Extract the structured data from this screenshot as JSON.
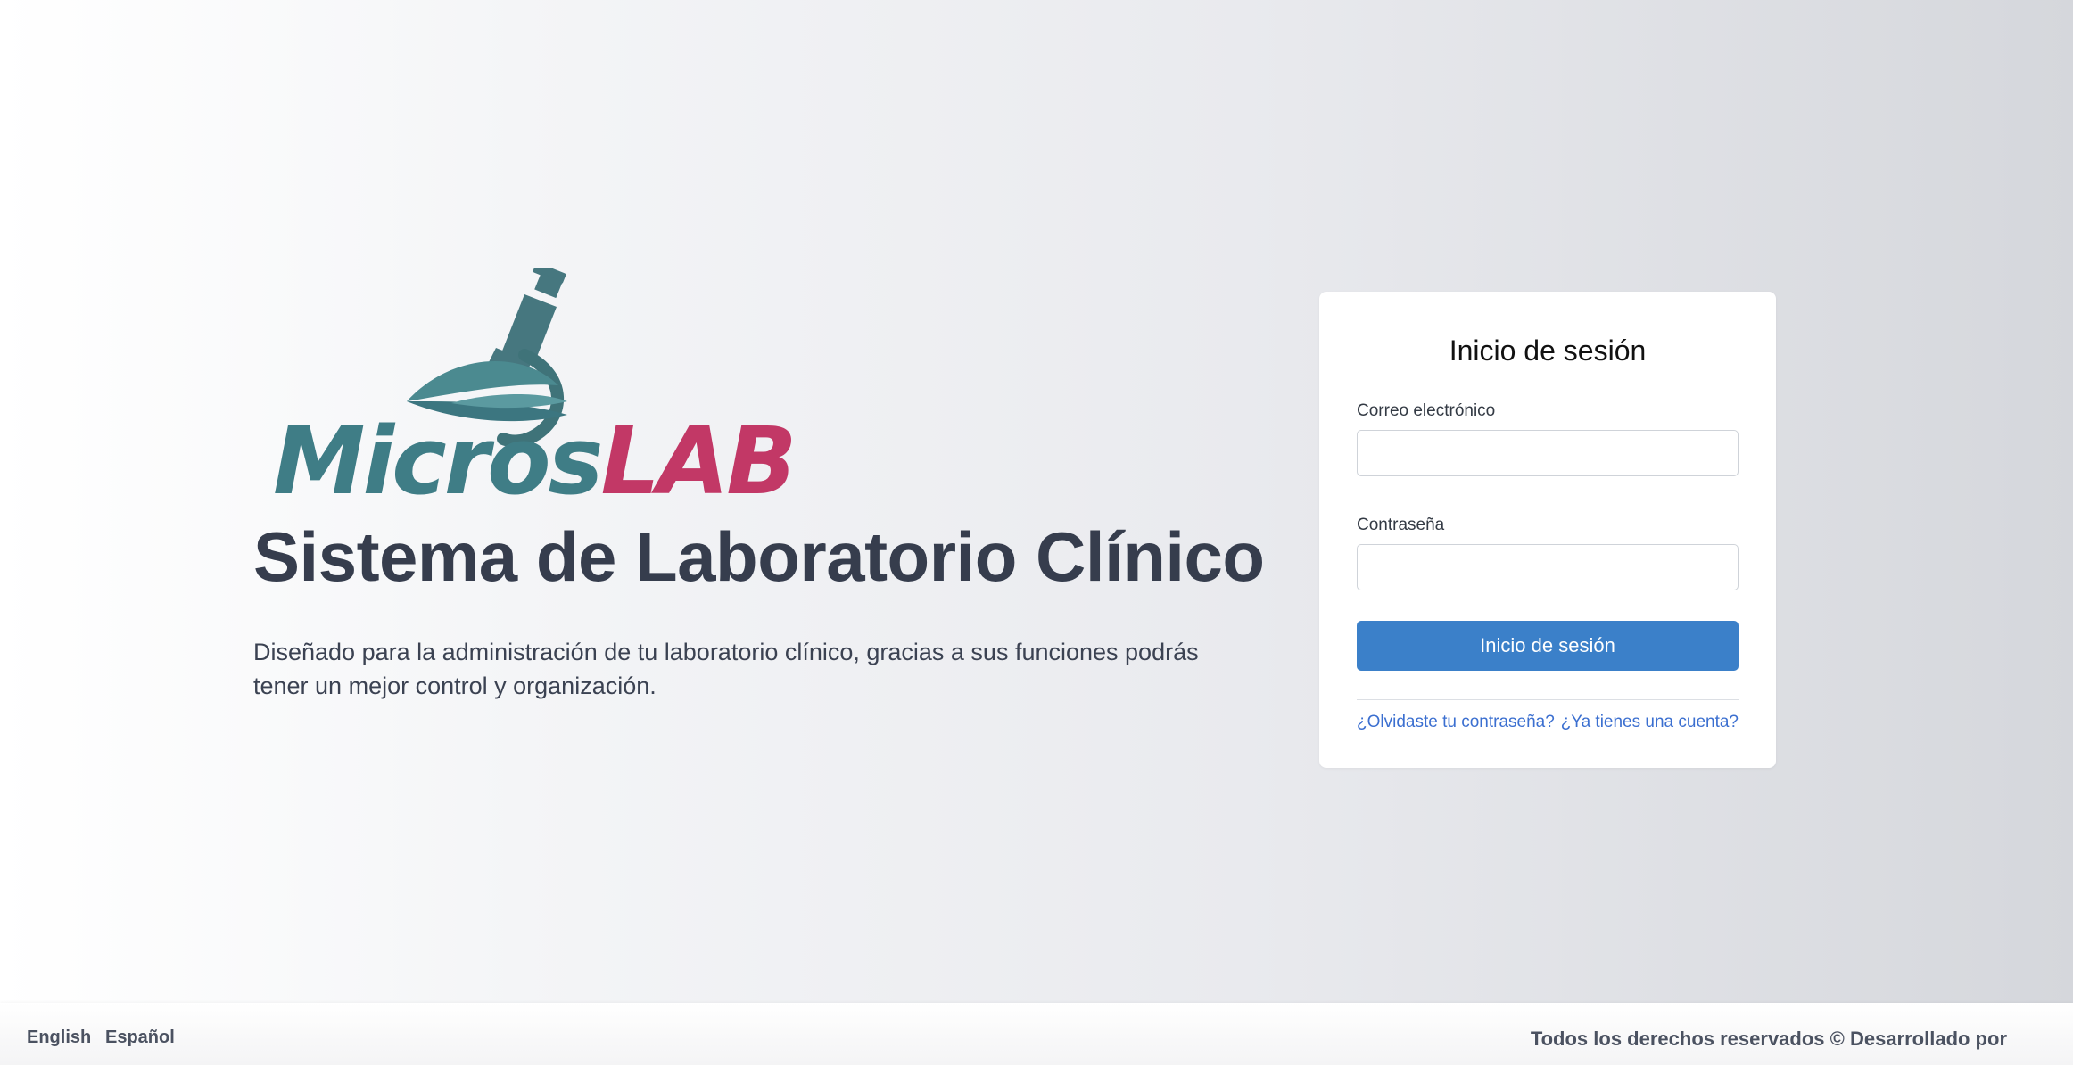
{
  "brand": {
    "logo_part1": "Micros",
    "logo_part2": "LAB",
    "colors": {
      "teal": "#3f7d86",
      "magenta": "#c23866"
    }
  },
  "hero": {
    "title": "Sistema de Laboratorio Clínico",
    "subtitle": "Diseñado para la administración de tu laboratorio clínico, gracias a sus funciones podrás tener un mejor control y organización."
  },
  "login": {
    "title": "Inicio de sesión",
    "email_label": "Correo electrónico",
    "email_value": "",
    "password_label": "Contraseña",
    "password_value": "",
    "submit_label": "Inicio de sesión",
    "forgot_link": "¿Olvidaste tu contraseña?",
    "account_link": "¿Ya tienes una cuenta?",
    "accent_color": "#3b80c9"
  },
  "footer": {
    "lang_en": "English",
    "lang_es": "Español",
    "copyright": "Todos los derechos reservados © Desarrollado por"
  }
}
